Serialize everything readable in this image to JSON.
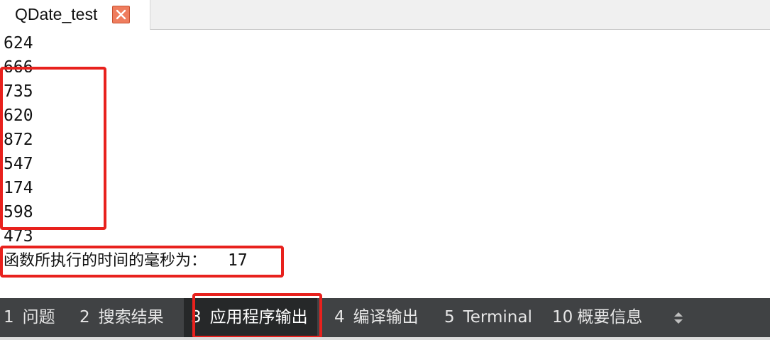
{
  "editor": {
    "tab_title": "QDate_test",
    "tab_close_icon": "close-x-icon"
  },
  "output": {
    "lines": [
      "624",
      "666",
      "735",
      "620",
      "872",
      "547",
      "174",
      "598",
      "473"
    ],
    "message_label": "函数所执行的时间的毫秒为：",
    "message_value": "17"
  },
  "bottom_tabs": [
    {
      "index": "1",
      "label": "问题"
    },
    {
      "index": "2",
      "label": "搜索结果"
    },
    {
      "index": "3",
      "label": "应用程序输出"
    },
    {
      "index": "4",
      "label": "编译输出"
    },
    {
      "index": "5",
      "label": "Terminal"
    },
    {
      "index": "10",
      "label": "概要信息"
    }
  ],
  "colors": {
    "annotation": "#e8211d",
    "bottom_bar": "#404244",
    "active_tab": "#262829",
    "close_button": "#ef7d5e"
  }
}
